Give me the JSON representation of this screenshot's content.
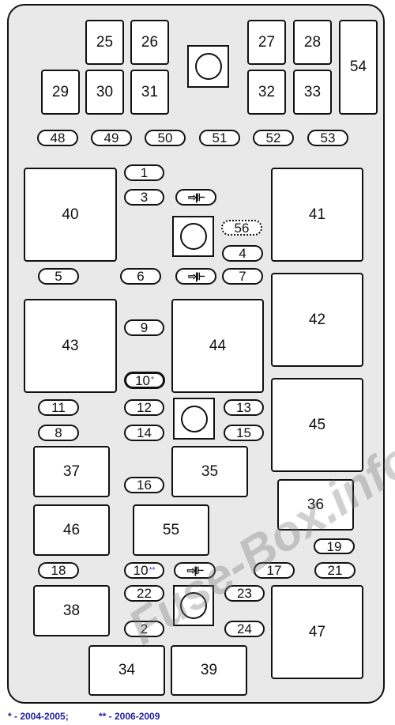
{
  "fuses": {
    "f1": "1",
    "f2": "2",
    "f3": "3",
    "f4": "4",
    "f5": "5",
    "f6": "6",
    "f7": "7",
    "f8": "8",
    "f9": "9",
    "f10a": "10",
    "f10b": "10",
    "f11": "11",
    "f12": "12",
    "f13": "13",
    "f14": "14",
    "f15": "15",
    "f16": "16",
    "f17": "17",
    "f18": "18",
    "f19": "19",
    "f21": "21",
    "f22": "22",
    "f23": "23",
    "f24": "24",
    "f48": "48",
    "f49": "49",
    "f50": "50",
    "f51": "51",
    "f52": "52",
    "f53": "53",
    "f56": "56"
  },
  "relays": {
    "r25": "25",
    "r26": "26",
    "r27": "27",
    "r28": "28",
    "r29": "29",
    "r30": "30",
    "r31": "31",
    "r32": "32",
    "r33": "33",
    "r34": "34",
    "r35": "35",
    "r36": "36",
    "r37": "37",
    "r38": "38",
    "r39": "39",
    "r40": "40",
    "r41": "41",
    "r42": "42",
    "r43": "43",
    "r44": "44",
    "r45": "45",
    "r46": "46",
    "r47": "47",
    "r54": "54",
    "r55": "55"
  },
  "markers": {
    "single": "*",
    "double": "**"
  },
  "diode_symbol": "⇨|⊩",
  "legend": {
    "note1": "* - 2004-2005;",
    "note2": "** - 2006-2009"
  },
  "watermark": "Fuse-Box.info",
  "colors": {
    "panel": "#e9e9e9",
    "legend": "#2020a0",
    "marker": "#3030c0"
  }
}
